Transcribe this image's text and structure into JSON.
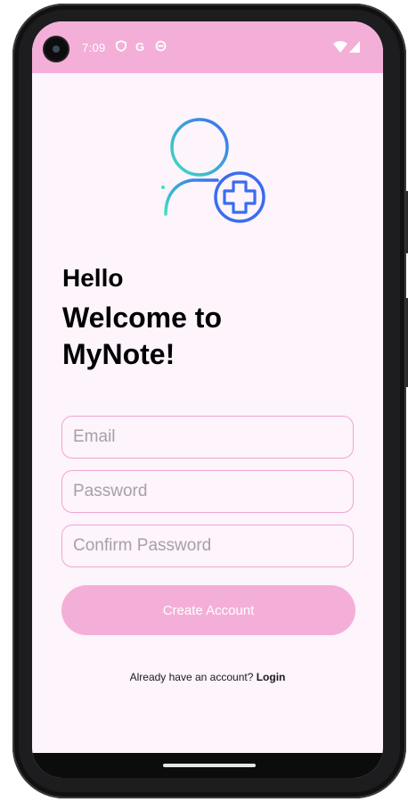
{
  "status_bar": {
    "time": "7:09",
    "icons": [
      "shield-icon",
      "google-g-icon",
      "sync-icon",
      "wifi-icon",
      "cellular-signal-icon"
    ],
    "google_glyph": "G"
  },
  "colors": {
    "accent_pink": "#f4afd8",
    "background": "#fdf4fc",
    "field_border": "#f0a6cf",
    "icon_gradient_start": "#3ee0c0",
    "icon_gradient_end": "#3a6cf0"
  },
  "header": {
    "greeting": "Hello",
    "welcome": "Welcome to MyNote!"
  },
  "form": {
    "email_placeholder": "Email",
    "password_placeholder": "Password",
    "confirm_placeholder": "Confirm Password",
    "submit_label": "Create Account"
  },
  "footer": {
    "prompt": "Already have an account?",
    "login_label": "Login"
  }
}
